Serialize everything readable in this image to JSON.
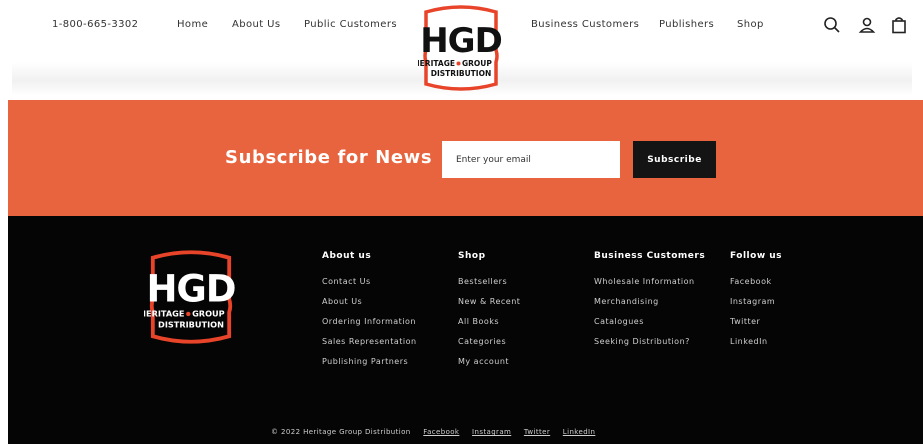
{
  "header": {
    "phone": "1-800-665-3302",
    "nav_left": [
      "Home",
      "About Us",
      "Public Customers"
    ],
    "nav_right": [
      "Business Customers",
      "Publishers",
      "Shop"
    ],
    "icons": [
      "search-icon",
      "account-icon",
      "cart-icon"
    ]
  },
  "logo": {
    "main": "HGD",
    "line1a": "HERITAGE",
    "line1b": "GROUP",
    "line2": "DISTRIBUTION"
  },
  "subscribe": {
    "title": "Subscribe for News",
    "email_placeholder": "Enter your email",
    "button_label": "Subscribe"
  },
  "footer": {
    "columns": [
      {
        "title": "About us",
        "links": [
          "Contact Us",
          "About Us",
          "Ordering Information",
          "Sales Representation",
          "Publishing Partners"
        ]
      },
      {
        "title": "Shop",
        "links": [
          "Bestsellers",
          "New & Recent",
          "All Books",
          "Categories",
          "My account"
        ]
      },
      {
        "title": "Business Customers",
        "links": [
          "Wholesale Information",
          "Merchandising",
          "Catalogues",
          "Seeking Distribution?"
        ]
      },
      {
        "title": "Follow us",
        "links": [
          "Facebook",
          "Instagram",
          "Twitter",
          "LinkedIn"
        ]
      }
    ],
    "copyright": "© 2022 Heritage Group Distribution",
    "social": [
      "Facebook",
      "Instagram",
      "Twitter",
      "LinkedIn"
    ]
  },
  "colors": {
    "accent": "#e8643e",
    "footer_bg": "#050505",
    "logo_red": "#e8442a"
  }
}
